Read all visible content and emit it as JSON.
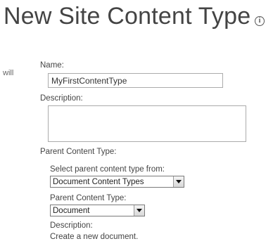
{
  "page": {
    "title": "New Site Content Type",
    "info_icon": "info-icon",
    "left_fragment": "will"
  },
  "form": {
    "name_label": "Name:",
    "name_value": "MyFirstContentType",
    "description_label": "Description:",
    "description_value": "",
    "parent_label": "Parent Content Type:",
    "select_from_label": "Select parent content type from:",
    "select_from_value": "Document Content Types",
    "parent_type_label": "Parent Content Type:",
    "parent_type_value": "Document",
    "parent_desc_label": "Description:",
    "parent_desc_text": "Create a new document."
  }
}
